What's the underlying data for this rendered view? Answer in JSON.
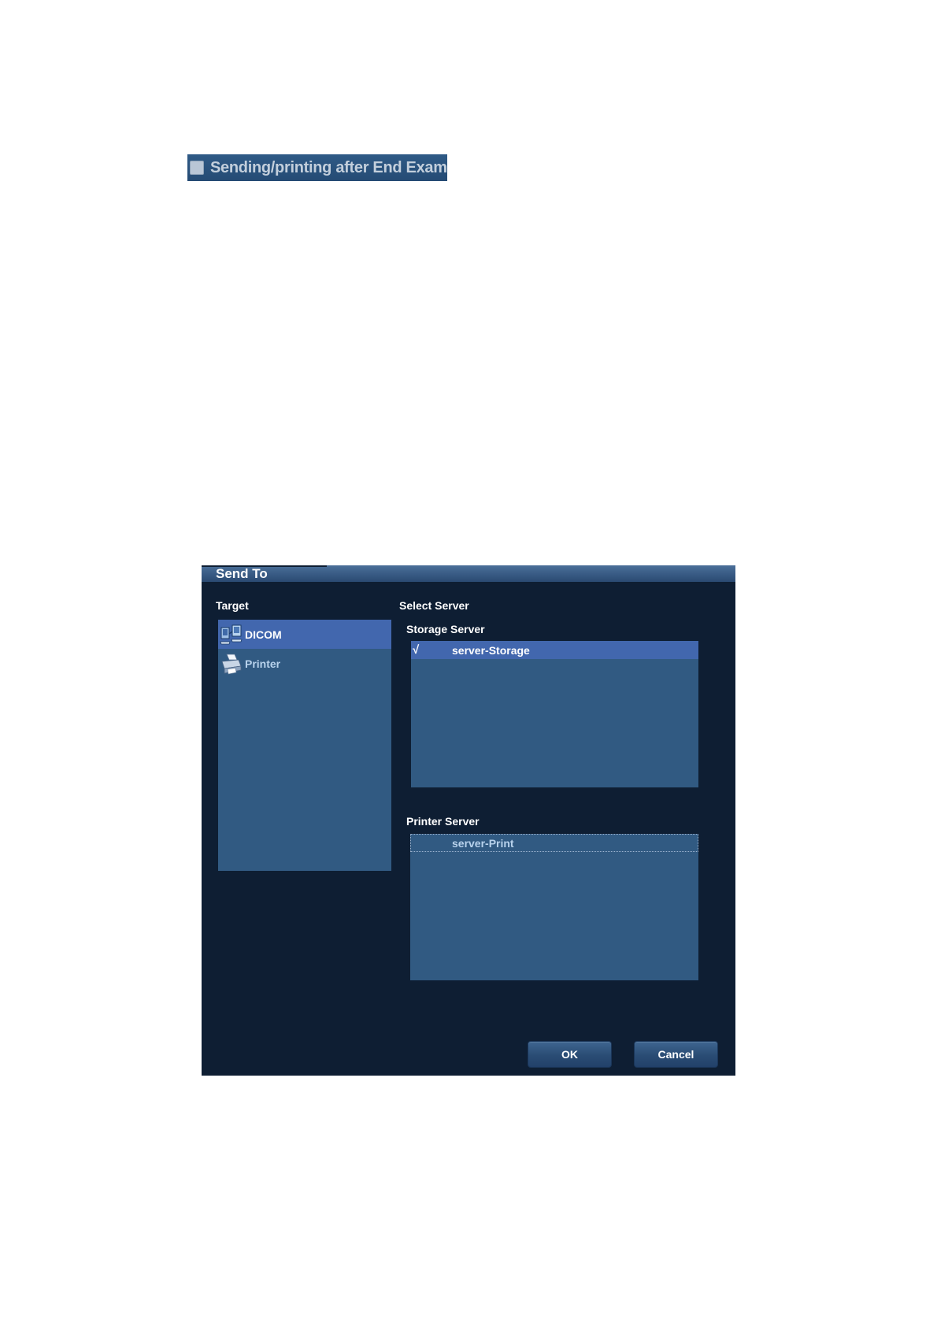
{
  "end_exam_option": {
    "label": "Sending/printing after End Exam",
    "checked": false
  },
  "dialog": {
    "title": "Send To",
    "target": {
      "heading": "Target",
      "items": [
        {
          "label": "DICOM",
          "icon": "dicom-network-icon",
          "selected": true
        },
        {
          "label": "Printer",
          "icon": "printer-icon",
          "selected": false
        }
      ]
    },
    "select_server": {
      "heading": "Select Server",
      "storage": {
        "heading": "Storage Server",
        "rows": [
          {
            "check": "√",
            "name": "server-Storage",
            "selected": true
          }
        ]
      },
      "printer": {
        "heading": "Printer Server",
        "rows": [
          {
            "check": "",
            "name": "server-Print",
            "selected": false
          }
        ]
      }
    },
    "buttons": {
      "ok": "OK",
      "cancel": "Cancel"
    }
  },
  "colors": {
    "dialog_bg": "#0e1e33",
    "list_bg": "#315a82",
    "selection": "#4267ae",
    "titlebar": "#3a5f8a"
  }
}
